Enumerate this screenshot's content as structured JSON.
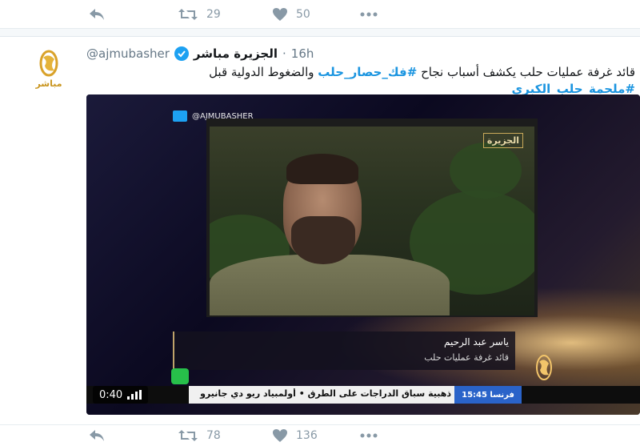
{
  "top_actions": {
    "retweets": "29",
    "likes": "50"
  },
  "tweet": {
    "handle": "@ajmubasher",
    "display_name": "الجزيرة مباشر",
    "time": "16h",
    "avatar_label": "مباشر",
    "text_prefix": "قائد غرفة عمليات حلب يكشف أسباب نجاح ",
    "hashtag1": "#فك_حصار_حلب",
    "text_middle": " والضغوط الدولية قبل ",
    "hashtag2": "#ملحمة_حلب_الكبرى"
  },
  "media": {
    "inner_handle": "@AJMUBASHER",
    "channel_logo": "الجزيرة",
    "lower_third_name": "ياسر عبد الرحيم",
    "lower_third_title": "قائد غرفة عمليات حلب",
    "ticker_tag": "فرنسا 15:45",
    "ticker_text": "ذهبية سباق الدراجات على الطرق   •   أولمبياد ريو دي جانيرو",
    "duration": "0:40"
  },
  "bottom_actions": {
    "retweets": "78",
    "likes": "136"
  },
  "colors": {
    "accent": "#1da1f2",
    "hashtag": "#1b95e0",
    "muted": "#8899a6"
  }
}
